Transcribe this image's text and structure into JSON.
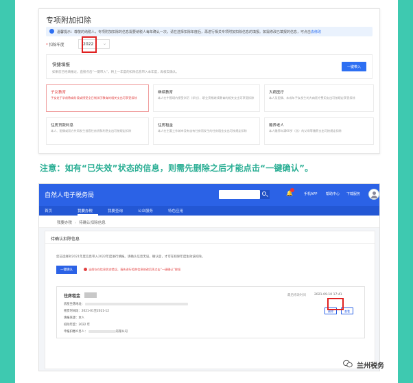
{
  "screenshot1": {
    "title": "专项附加扣除",
    "tip": "温馨提示：尊敬的纳税人，专项附加扣除的信息需要纳税人每年确认一次，请在选择扣除年度后，再进行相关专项附加扣除信息的填报。如需修改已填报的信息，可点击",
    "tip_link": "去修改",
    "year_label": "扣除年度",
    "year_required": "*",
    "year_value": "2022",
    "quick": {
      "title": "快捷填报",
      "desc": "如果您已经填报过，直接点击“一键带入”，将上一年度的扣除信息带入本年度，再核实确认。",
      "button": "一键带入"
    },
    "cards": [
      {
        "title": "子女教育",
        "desc": "子女处于学前教育阶段或接受全日制学历教育的相关支出可享受扣除",
        "active": true
      },
      {
        "title": "继续教育",
        "desc": "本人在中国境内接受学历（学位）、职业资格继续教育的相关支出可享受扣除",
        "active": false
      },
      {
        "title": "大病医疗",
        "desc": "本人及配偶、未成年子女发生的大病医疗费用支出可按规定享受扣除",
        "active": false
      },
      {
        "title": "住房贷款利息",
        "desc": "本人、配偶或双方共同发生首套住房贷款利息支出可按规定扣除",
        "active": false
      },
      {
        "title": "住房租金",
        "desc": "本人在主要工作城市没有自有住房而发生的住房租金支出可按规定扣除",
        "active": false
      },
      {
        "title": "赡养老人",
        "desc": "本人赡养年满60岁（含）的父母等赡养支出可按规定扣除",
        "active": false
      }
    ]
  },
  "caption": "注意：如有“已失效”状态的信息，则需先删除之后才能点击“一键确认”。",
  "screenshot2": {
    "brand": "自然人电子税务局",
    "header_links": {
      "app": "手机APP",
      "help": "帮助中心",
      "download": "下载服务"
    },
    "nav": [
      "首页",
      "我要办税",
      "我要查询",
      "公众服务",
      "特色应用"
    ],
    "breadcrumb": [
      "我要办税",
      "待确认扣除信息"
    ],
    "panel_title": "待确认扣除信息",
    "desc": "您已选择对2021年度信息带入2022年度进行填报。请确认信息无误，确认后，才可在扣除年度生效该扣除。",
    "confirm_button": "一键确认",
    "warning": "当前存在信息状态错误，请先进行相关信息修改后再点击“一键确认”按钮",
    "record": {
      "title": "住房租金",
      "time_label": "最后修改时间",
      "time_value": "2021-09-10 17:41",
      "lines": [
        {
          "label": "房屋坐落地址："
        },
        {
          "label": "租赁时间段：",
          "value": "2021-01至2021-12"
        },
        {
          "label": "填报来源：",
          "value": "本人"
        },
        {
          "label": "扣除年度：",
          "value": "2022 年"
        },
        {
          "label": "申报扣缴义务人：",
          "suffix": "有限公司"
        }
      ],
      "delete_button": "删除",
      "view_button": "查看"
    }
  },
  "watermark": "兰州税务",
  "colors": {
    "frame": "#3ec9b0",
    "caption": "#2aae94",
    "brand_blue": "#2b62e6",
    "alert_red": "#e02020"
  }
}
